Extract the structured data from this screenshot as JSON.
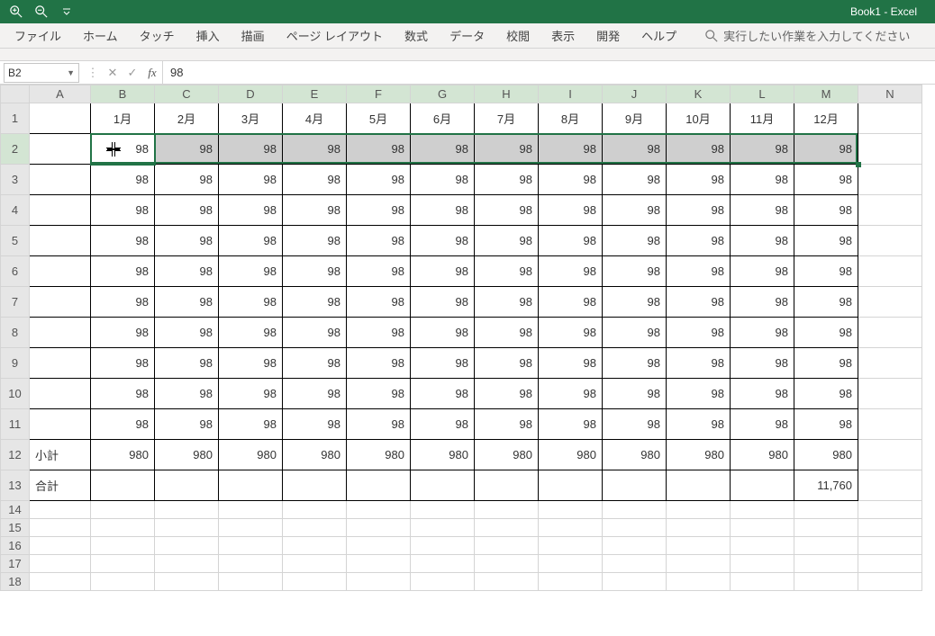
{
  "app": {
    "title": "Book1  -  Excel"
  },
  "ribbon": {
    "tabs": [
      "ファイル",
      "ホーム",
      "タッチ",
      "挿入",
      "描画",
      "ページ レイアウト",
      "数式",
      "データ",
      "校閲",
      "表示",
      "開発",
      "ヘルプ"
    ],
    "tell_me_placeholder": "実行したい作業を入力してください"
  },
  "formula_bar": {
    "name_box": "B2",
    "fx_label": "fx",
    "value": "98"
  },
  "grid": {
    "columns": [
      "A",
      "B",
      "C",
      "D",
      "E",
      "F",
      "G",
      "H",
      "I",
      "J",
      "K",
      "L",
      "M",
      "N"
    ],
    "row_numbers": [
      1,
      2,
      3,
      4,
      5,
      6,
      7,
      8,
      9,
      10,
      11,
      12,
      13,
      14,
      15,
      16,
      17,
      18
    ],
    "labels": {
      "subtotal": "小計",
      "total": "合計"
    },
    "months": [
      "1月",
      "2月",
      "3月",
      "4月",
      "5月",
      "6月",
      "7月",
      "8月",
      "9月",
      "10月",
      "11月",
      "12月"
    ],
    "data_value": 98,
    "subtotal_value": 980,
    "total_value": "11,760",
    "selection": {
      "start": "B2",
      "end": "M2",
      "active": "B2"
    }
  },
  "chart_data": {
    "type": "table",
    "title": "",
    "columns": [
      "1月",
      "2月",
      "3月",
      "4月",
      "5月",
      "6月",
      "7月",
      "8月",
      "9月",
      "10月",
      "11月",
      "12月"
    ],
    "rows": [
      {
        "label": "",
        "values": [
          98,
          98,
          98,
          98,
          98,
          98,
          98,
          98,
          98,
          98,
          98,
          98
        ]
      },
      {
        "label": "",
        "values": [
          98,
          98,
          98,
          98,
          98,
          98,
          98,
          98,
          98,
          98,
          98,
          98
        ]
      },
      {
        "label": "",
        "values": [
          98,
          98,
          98,
          98,
          98,
          98,
          98,
          98,
          98,
          98,
          98,
          98
        ]
      },
      {
        "label": "",
        "values": [
          98,
          98,
          98,
          98,
          98,
          98,
          98,
          98,
          98,
          98,
          98,
          98
        ]
      },
      {
        "label": "",
        "values": [
          98,
          98,
          98,
          98,
          98,
          98,
          98,
          98,
          98,
          98,
          98,
          98
        ]
      },
      {
        "label": "",
        "values": [
          98,
          98,
          98,
          98,
          98,
          98,
          98,
          98,
          98,
          98,
          98,
          98
        ]
      },
      {
        "label": "",
        "values": [
          98,
          98,
          98,
          98,
          98,
          98,
          98,
          98,
          98,
          98,
          98,
          98
        ]
      },
      {
        "label": "",
        "values": [
          98,
          98,
          98,
          98,
          98,
          98,
          98,
          98,
          98,
          98,
          98,
          98
        ]
      },
      {
        "label": "",
        "values": [
          98,
          98,
          98,
          98,
          98,
          98,
          98,
          98,
          98,
          98,
          98,
          98
        ]
      },
      {
        "label": "",
        "values": [
          98,
          98,
          98,
          98,
          98,
          98,
          98,
          98,
          98,
          98,
          98,
          98
        ]
      },
      {
        "label": "小計",
        "values": [
          980,
          980,
          980,
          980,
          980,
          980,
          980,
          980,
          980,
          980,
          980,
          980
        ]
      },
      {
        "label": "合計",
        "values": [
          null,
          null,
          null,
          null,
          null,
          null,
          null,
          null,
          null,
          null,
          null,
          11760
        ]
      }
    ]
  }
}
